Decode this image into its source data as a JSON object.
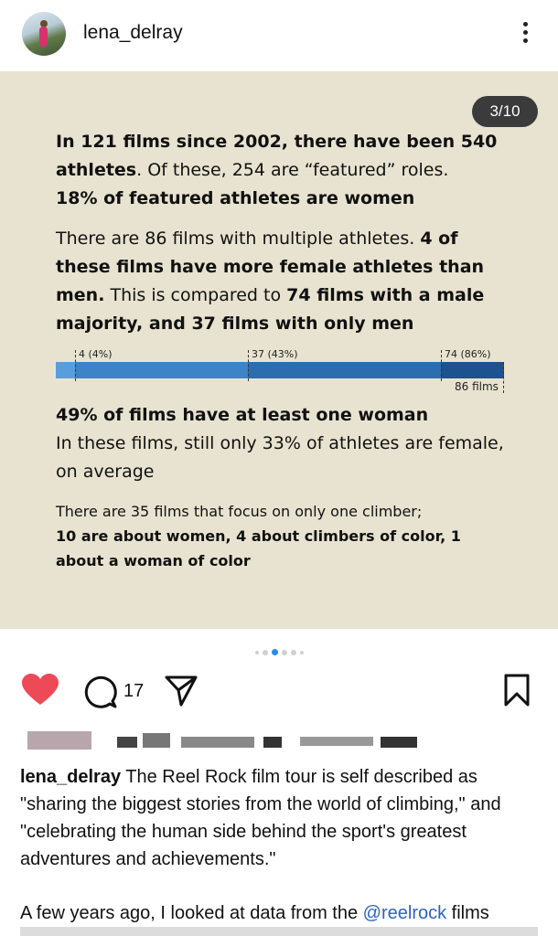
{
  "header": {
    "username": "lena_delray"
  },
  "post": {
    "counter": "3/10",
    "p1": {
      "b1": "In 121 films since 2002, there have been 540 athletes",
      "t1": ". Of these, 254 are “featured” roles.",
      "b2": "18% of featured athletes are women"
    },
    "p2": {
      "t1": "There are 86 films with multiple athletes. ",
      "b1": "4 of these films have more female athletes than men.",
      "t2": " This is compared to ",
      "b2": "74 films with a male majority, and 37 films with only men"
    },
    "bar": {
      "labels": [
        "4 (4%)",
        "37 (43%)",
        "74 (86%)"
      ],
      "total_label": "86 films",
      "values": [
        4,
        37,
        74,
        86
      ]
    },
    "p3": {
      "b1": "49% of films have at least one woman",
      "t1": "In these films, still only 33% of athletes are female, on average"
    },
    "p4": {
      "t1": "There are 35 films that focus on only one climber;",
      "b1": "10 are about women, 4 about climbers of color, 1 about a woman of color"
    }
  },
  "carousel": {
    "active_index": 2,
    "count": 6
  },
  "actions": {
    "comment_count": "17",
    "like_color": "#ed4956"
  },
  "caption": {
    "username": "lena_delray",
    "text": "The Reel Rock film tour is self described as \"sharing the biggest stories from the world of climbing,\" and \"celebrating the human side behind the sport's greatest adventures and achievements.\"",
    "line2_prefix": "A few years ago, I looked at data from the ",
    "mention": "@reelrock",
    "line2_suffix": " films"
  },
  "colors": {
    "post_bg": "#e8e3d0",
    "accent": "#2a8ae6"
  }
}
